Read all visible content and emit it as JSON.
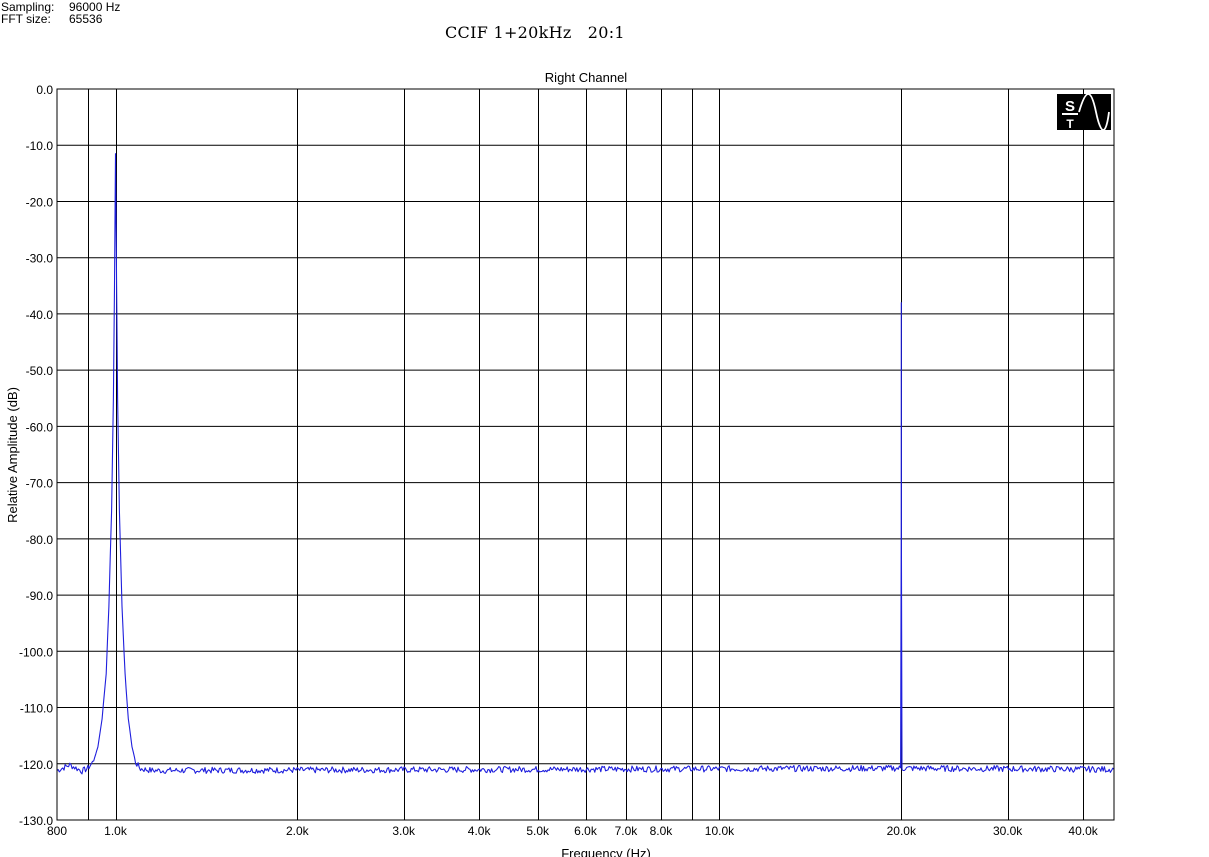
{
  "info": {
    "sampling_label": "Sampling:",
    "sampling_value": "96000 Hz",
    "fft_label": "FFT size:",
    "fft_value": "65536"
  },
  "main_title": "CCIF 1+20kHz   20:1",
  "logo": {
    "top": "S",
    "bottom": "T"
  },
  "colors": {
    "trace": "#1f1fdd",
    "grid": "#000000",
    "background": "#ffffff",
    "logo_bg": "#000000",
    "logo_fg": "#ffffff"
  },
  "chart_data": {
    "type": "line",
    "title": "Right Channel",
    "xlabel": "Frequency (Hz)",
    "ylabel": "Relative Amplitude (dB)",
    "x_scale": "log",
    "xlim": [
      800,
      45000
    ],
    "ylim": [
      -130,
      0
    ],
    "grid": true,
    "yticks": [
      0,
      -10,
      -20,
      -30,
      -40,
      -50,
      -60,
      -70,
      -80,
      -90,
      -100,
      -110,
      -120,
      -130
    ],
    "ytick_labels": [
      "0.0",
      "-10.0",
      "-20.0",
      "-30.0",
      "-40.0",
      "-50.0",
      "-60.0",
      "-70.0",
      "-80.0",
      "-90.0",
      "-100.0",
      "-110.0",
      "-120.0",
      "-130.0"
    ],
    "xticks": [
      800,
      1000,
      2000,
      3000,
      4000,
      5000,
      6000,
      7000,
      8000,
      10000,
      20000,
      30000,
      40000
    ],
    "xtick_labels": [
      "800",
      "1.0k",
      "2.0k",
      "3.0k",
      "4.0k",
      "5.0k",
      "6.0k",
      "7.0k",
      "8.0k",
      "10.0k",
      "20.0k",
      "30.0k",
      "40.0k"
    ],
    "xgrid": [
      900,
      1000,
      2000,
      3000,
      4000,
      5000,
      6000,
      7000,
      8000,
      9000,
      10000,
      20000,
      30000,
      40000
    ],
    "series": [
      {
        "noise_floor": -121,
        "points": [
          [
            800,
            -121.2
          ],
          [
            840,
            -120.2
          ],
          [
            880,
            -121.3
          ],
          [
            900,
            -120.8
          ],
          [
            920,
            -119.5
          ],
          [
            935,
            -117
          ],
          [
            950,
            -112
          ],
          [
            965,
            -104
          ],
          [
            975,
            -92
          ],
          [
            985,
            -75
          ],
          [
            992,
            -55
          ],
          [
            996,
            -35
          ],
          [
            1000,
            -11.5
          ],
          [
            1004,
            -35
          ],
          [
            1008,
            -55
          ],
          [
            1015,
            -75
          ],
          [
            1025,
            -92
          ],
          [
            1037,
            -104
          ],
          [
            1050,
            -112
          ],
          [
            1065,
            -117
          ],
          [
            1080,
            -119.8
          ],
          [
            1100,
            -120.9
          ],
          [
            1150,
            -121.2
          ],
          [
            19950,
            -120.8
          ],
          [
            19995,
            -80
          ],
          [
            20000,
            -38
          ],
          [
            20005,
            -80
          ],
          [
            20050,
            -120.8
          ],
          [
            45000,
            -121
          ]
        ]
      }
    ],
    "annotations": []
  }
}
